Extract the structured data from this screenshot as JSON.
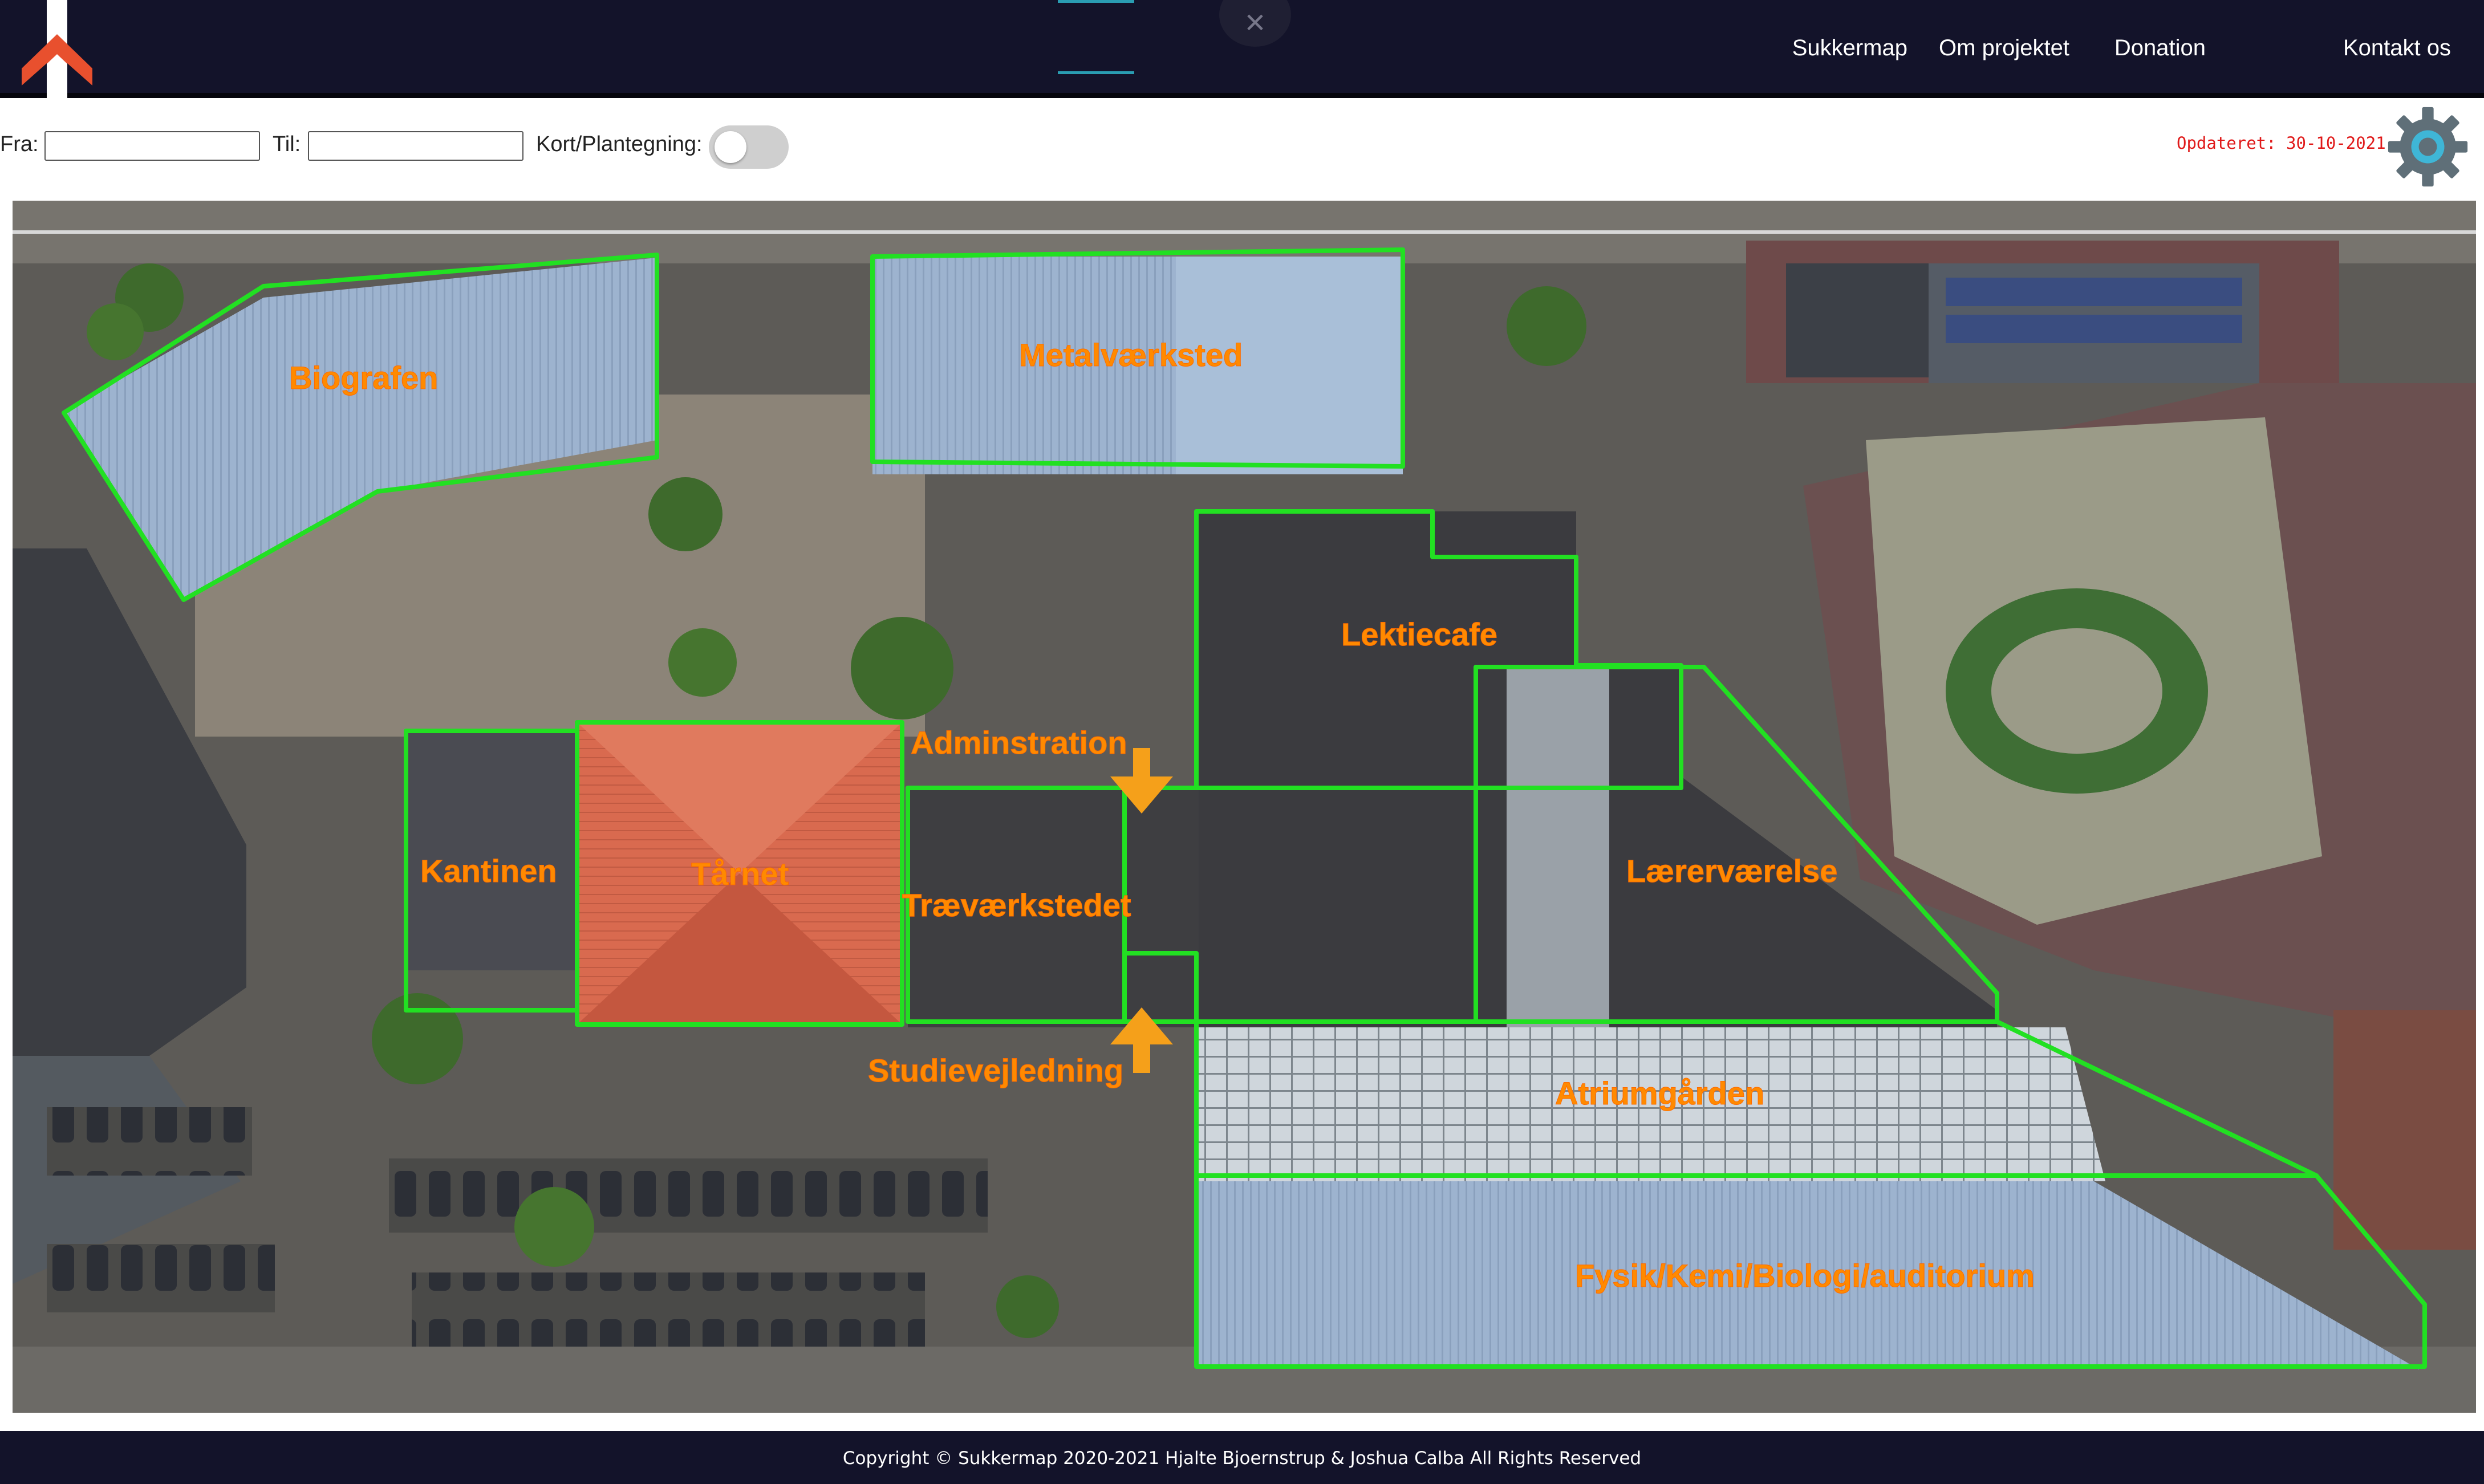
{
  "header": {
    "nav": [
      "Sukkermap",
      "Om projektet",
      "Donation",
      "Kontakt os"
    ],
    "close_icon": "×"
  },
  "controls": {
    "from_label": "Fra:",
    "from_value": "",
    "to_label": "Til:",
    "to_value": "",
    "toggle_label": "Kort/Plantegning:",
    "toggle_on": false,
    "updated": "Opdateret: 30-10-2021"
  },
  "map": {
    "rooms": [
      "Biografen",
      "Metalværksted",
      "Lektiecafe",
      "Adminstration",
      "Kantinen",
      "Tårnet",
      "Træværkstedet",
      "Lærerværelse",
      "Studievejledning",
      "Atriumgården",
      "Fysik/Kemi/Biologi/auditorium"
    ],
    "outline_color": "#22e022",
    "label_color": "#ff8a00"
  },
  "footer": {
    "copyright": "Copyright © Sukkermap 2020-2021 Hjalte Bjoernstrup & Joshua Calba All Rights Reserved"
  },
  "icons": {
    "logo": "arrow-up-logo-icon",
    "close": "close-icon",
    "settings": "gear-icon",
    "direction": "arrow-icon"
  }
}
